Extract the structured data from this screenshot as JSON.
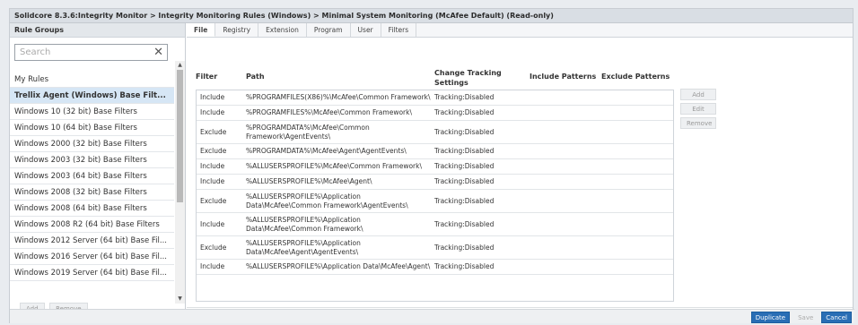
{
  "window": {
    "title": "Solidcore 8.3.6:Integrity Monitor > Integrity Monitoring Rules (Windows) > Minimal System Monitoring (McAfee Default) (Read-only)"
  },
  "left": {
    "header": "Rule Groups",
    "search_placeholder": "Search",
    "items": [
      {
        "label": "My Rules"
      },
      {
        "label": "Trellix Agent (Windows) Base Filt..."
      },
      {
        "label": "Windows 10 (32 bit) Base Filters"
      },
      {
        "label": "Windows 10 (64 bit) Base Filters"
      },
      {
        "label": "Windows 2000 (32 bit) Base Filters"
      },
      {
        "label": "Windows 2003 (32 bit) Base Filters"
      },
      {
        "label": "Windows 2003 (64 bit) Base Filters"
      },
      {
        "label": "Windows 2008 (32 bit) Base Filters"
      },
      {
        "label": "Windows 2008 (64 bit) Base Filters"
      },
      {
        "label": "Windows 2008 R2 (64 bit) Base Filters"
      },
      {
        "label": "Windows 2012 Server (64 bit) Base Fil..."
      },
      {
        "label": "Windows 2016 Server (64 bit) Base Fil..."
      },
      {
        "label": "Windows 2019 Server (64 bit) Base Fil..."
      }
    ],
    "selected_index": 1,
    "add_label": "Add",
    "remove_label": "Remove"
  },
  "tabs": [
    "File",
    "Registry",
    "Extension",
    "Program",
    "User",
    "Filters"
  ],
  "columns": {
    "filter": "Filter",
    "path": "Path",
    "change_tracking": "Change Tracking Settings",
    "include_patterns": "Include Patterns",
    "exclude_patterns": "Exclude Patterns"
  },
  "rows": [
    {
      "filter": "Include",
      "path": "%PROGRAMFILES(X86)%\\McAfee\\Common Framework\\",
      "tracking": "Tracking:Disabled"
    },
    {
      "filter": "Include",
      "path": "%PROGRAMFILES%\\McAfee\\Common Framework\\",
      "tracking": "Tracking:Disabled"
    },
    {
      "filter": "Exclude",
      "path": "%PROGRAMDATA%\\McAfee\\Common Framework\\AgentEvents\\",
      "tracking": "Tracking:Disabled"
    },
    {
      "filter": "Exclude",
      "path": "%PROGRAMDATA%\\McAfee\\Agent\\AgentEvents\\",
      "tracking": "Tracking:Disabled"
    },
    {
      "filter": "Include",
      "path": "%ALLUSERSPROFILE%\\McAfee\\Common Framework\\",
      "tracking": "Tracking:Disabled"
    },
    {
      "filter": "Include",
      "path": "%ALLUSERSPROFILE%\\McAfee\\Agent\\",
      "tracking": "Tracking:Disabled"
    },
    {
      "filter": "Exclude",
      "path": "%ALLUSERSPROFILE%\\Application Data\\McAfee\\Common Framework\\AgentEvents\\",
      "tracking": "Tracking:Disabled"
    },
    {
      "filter": "Include",
      "path": "%ALLUSERSPROFILE%\\Application Data\\McAfee\\Common Framework\\",
      "tracking": "Tracking:Disabled"
    },
    {
      "filter": "Exclude",
      "path": "%ALLUSERSPROFILE%\\Application Data\\McAfee\\Agent\\AgentEvents\\",
      "tracking": "Tracking:Disabled"
    },
    {
      "filter": "Include",
      "path": "%ALLUSERSPROFILE%\\Application Data\\McAfee\\Agent\\",
      "tracking": "Tracking:Disabled"
    }
  ],
  "side_buttons": {
    "add": "Add",
    "edit": "Edit",
    "remove": "Remove"
  },
  "footer": {
    "duplicate": "Duplicate",
    "save": "Save",
    "cancel": "Cancel"
  }
}
